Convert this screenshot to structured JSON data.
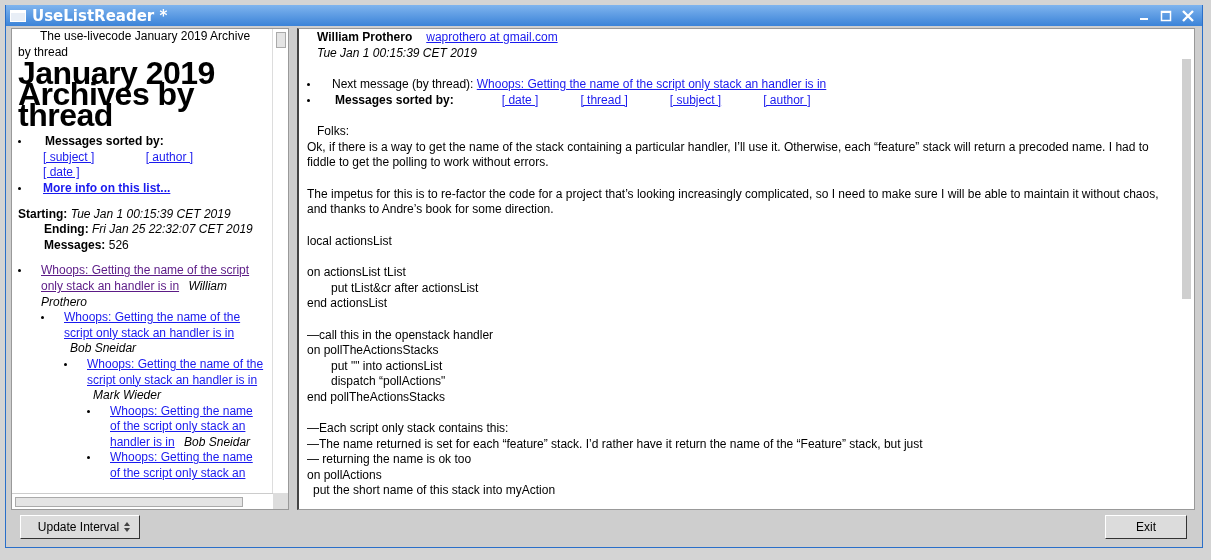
{
  "window": {
    "title": "UseListReader *"
  },
  "archive": {
    "intro": "The use-livecode January 2019 Archive by thread",
    "heading": "January 2019 Archives by thread",
    "sorted_label": "Messages sorted by:",
    "sort_links": [
      "[ subject ]",
      "[ author ]",
      "[ date ]"
    ],
    "info_link": "More info on this list...",
    "stats": [
      {
        "label": "Starting:",
        "value": "Tue Jan  1 00:15:39 CET 2019",
        "kind": "date"
      },
      {
        "label": "Ending:",
        "value": "Fri Jan 25 22:32:07 CET 2019",
        "kind": "date"
      },
      {
        "label": "Messages:",
        "value": "526",
        "kind": "count"
      }
    ],
    "threads": [
      {
        "subject": "Whoops: Getting the name of the script only stack an handler is in",
        "author": "William Prothero",
        "visited": true,
        "children": [
          {
            "subject": "Whoops: Getting the name of the script only stack an handler is in",
            "author": "Bob Sneidar",
            "visited": false,
            "children": [
              {
                "subject": "Whoops: Getting the name of the script only stack an handler is in",
                "author": "Mark Wieder",
                "visited": false,
                "children": [
                  {
                    "subject": "Whoops: Getting the name of the script only stack an handler is in",
                    "author": "Bob Sneidar",
                    "visited": false
                  },
                  {
                    "subject": "Whoops: Getting the name of the script only stack an",
                    "visited": false
                  }
                ]
              }
            ]
          }
        ]
      }
    ]
  },
  "message": {
    "sender": "William Prothero",
    "email": "waprothero at gmail.com",
    "date": "Tue Jan  1 00:15:39 CET 2019",
    "next_label": "Next message (by thread):",
    "next_link": "Whoops: Getting the name of the script only stack an handler is in",
    "sorted_label": "Messages sorted by:",
    "sort_links": [
      "[ date ]",
      "[ thread ]",
      "[ subject ]",
      "[ author ]"
    ],
    "greeting": "Folks:",
    "body": [
      [
        {
          "kind": "plain",
          "text": "Ok, if there is a way to get the name of the stack containing a particular handler, I’ll use it. Otherwise, each “feature” stack will return a precoded name. I had to fiddle to get the polling to work without errors."
        }
      ],
      [
        {
          "kind": "plain",
          "text": "The impetus for this is to re-factor the code for a project that’s looking increasingly complicated, so I need to make sure I will be able to maintain it without chaos, and thanks to Andre’s book for some direction."
        }
      ],
      [
        {
          "kind": "plain",
          "text": "local actionsList"
        }
      ],
      [
        {
          "kind": "plain",
          "text": "on actionsList tList"
        },
        {
          "kind": "indented",
          "text": "put tList&cr after actionsList"
        },
        {
          "kind": "plain",
          "text": "end actionsList"
        }
      ],
      [
        {
          "kind": "plain",
          "text": "—call this in the openstack handler"
        },
        {
          "kind": "plain",
          "text": "on pollTheActionsStacks"
        },
        {
          "kind": "indented",
          "text": "put \"\" into actionsList"
        },
        {
          "kind": "indented",
          "text": "dispatch  “pollActions\""
        },
        {
          "kind": "plain",
          "text": "end pollTheActionsStacks"
        }
      ],
      [
        {
          "kind": "plain",
          "text": "—Each script only stack contains this:"
        },
        {
          "kind": "plain",
          "text": "—The name returned is set for each “feature” stack. I’d rather have it return the name of the “Feature” stack, but just"
        },
        {
          "kind": "plain",
          "text": "—   returning the name is ok too"
        },
        {
          "kind": "plain",
          "text": "on pollActions"
        },
        {
          "kind": "half",
          "text": "put the short name of this stack into myAction"
        }
      ]
    ]
  },
  "footer": {
    "interval_button": "Update Interval",
    "exit_button": "Exit"
  }
}
